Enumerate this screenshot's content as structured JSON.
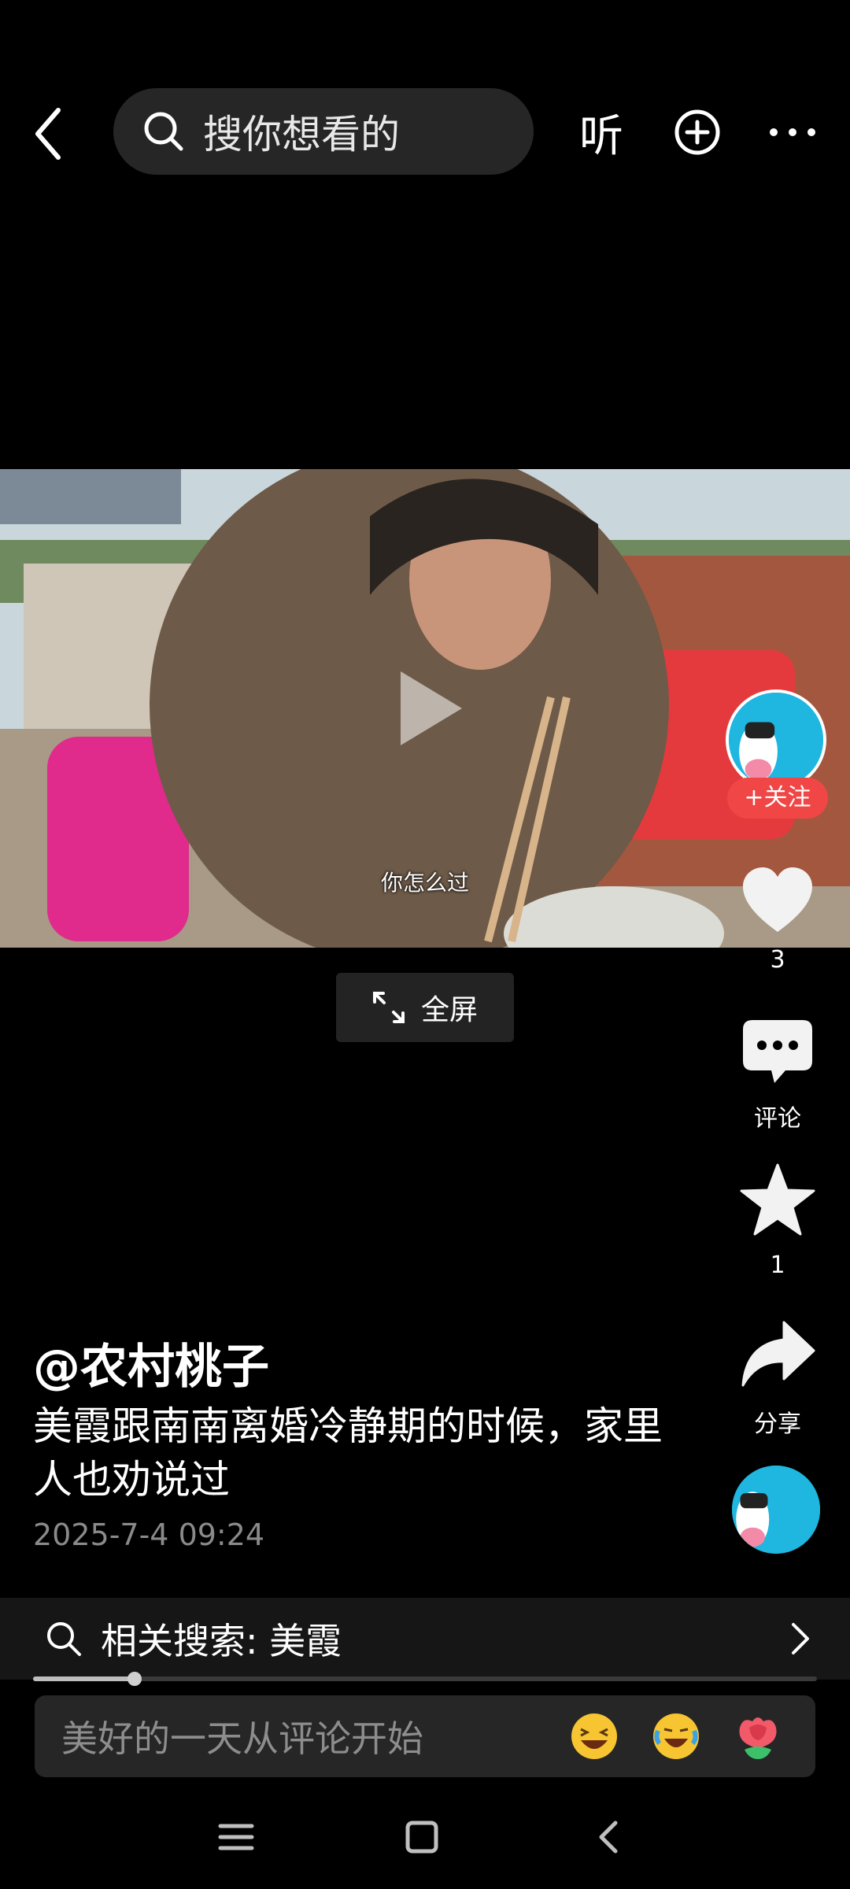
{
  "top_bar": {
    "search_placeholder": "搜你想看的",
    "listen_label": "听",
    "icons": [
      "back-arrow-icon",
      "search-icon",
      "add-circle-icon",
      "more-horizontal-icon"
    ]
  },
  "video": {
    "subtitle": "你怎么过",
    "fullscreen_label": "全屏"
  },
  "side_rail": {
    "follow_label": "+关注",
    "like_count": "3",
    "comment_label": "评论",
    "favorite_count": "1",
    "share_label": "分享"
  },
  "post": {
    "author": "@农村桃子",
    "description": "美霞跟南南离婚冷静期的时候，家里人也劝说过",
    "date": "2025-7-4 09:24"
  },
  "related_search": {
    "label": "相关搜索: 美霞"
  },
  "playback": {
    "progress_fraction": 0.13
  },
  "comment_input": {
    "placeholder": "美好的一天从评论开始",
    "emojis": [
      "grinning-squint-emoji",
      "crying-laughing-emoji",
      "rose-emoji"
    ]
  },
  "colors": {
    "follow_red": "#f04646",
    "avatar_blue": "#1fb6e0",
    "background": "#000000"
  }
}
